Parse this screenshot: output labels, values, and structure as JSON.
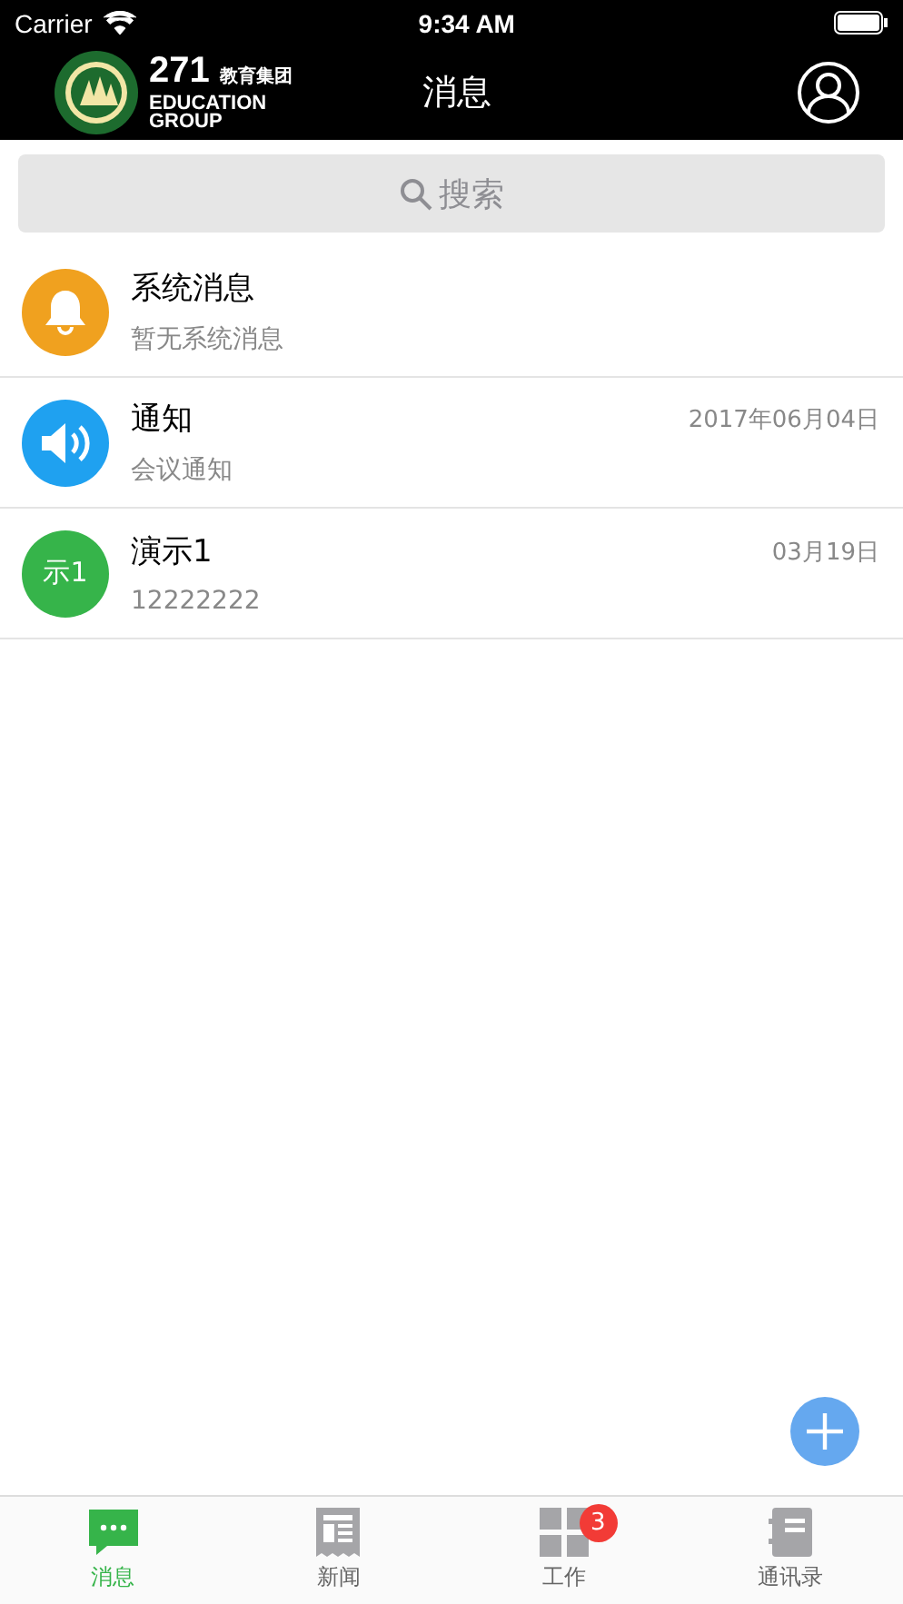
{
  "status_bar": {
    "carrier": "Carrier",
    "time": "9:34 AM"
  },
  "nav": {
    "logo_number": "271",
    "logo_cn": "教育集团",
    "logo_line1": "EDUCATION",
    "logo_line2": "GROUP",
    "title": "消息"
  },
  "search": {
    "placeholder": "搜索"
  },
  "messages": [
    {
      "kind": "bell",
      "color": "#f0a11f",
      "title": "系统消息",
      "preview": "暂无系统消息"
    },
    {
      "kind": "speaker",
      "color": "#1fa1f0",
      "title": "通知",
      "preview": "会议通知",
      "date": "2017年06月04日"
    },
    {
      "kind": "text",
      "color": "#36b44a",
      "avatar_text": "示1",
      "title": "演示1",
      "preview": "12222222",
      "date": "03月19日"
    }
  ],
  "tabs": [
    {
      "label": "消息",
      "selected": true
    },
    {
      "label": "新闻",
      "selected": false
    },
    {
      "label": "工作",
      "selected": false,
      "badge": "3"
    },
    {
      "label": "通讯录",
      "selected": false
    }
  ]
}
